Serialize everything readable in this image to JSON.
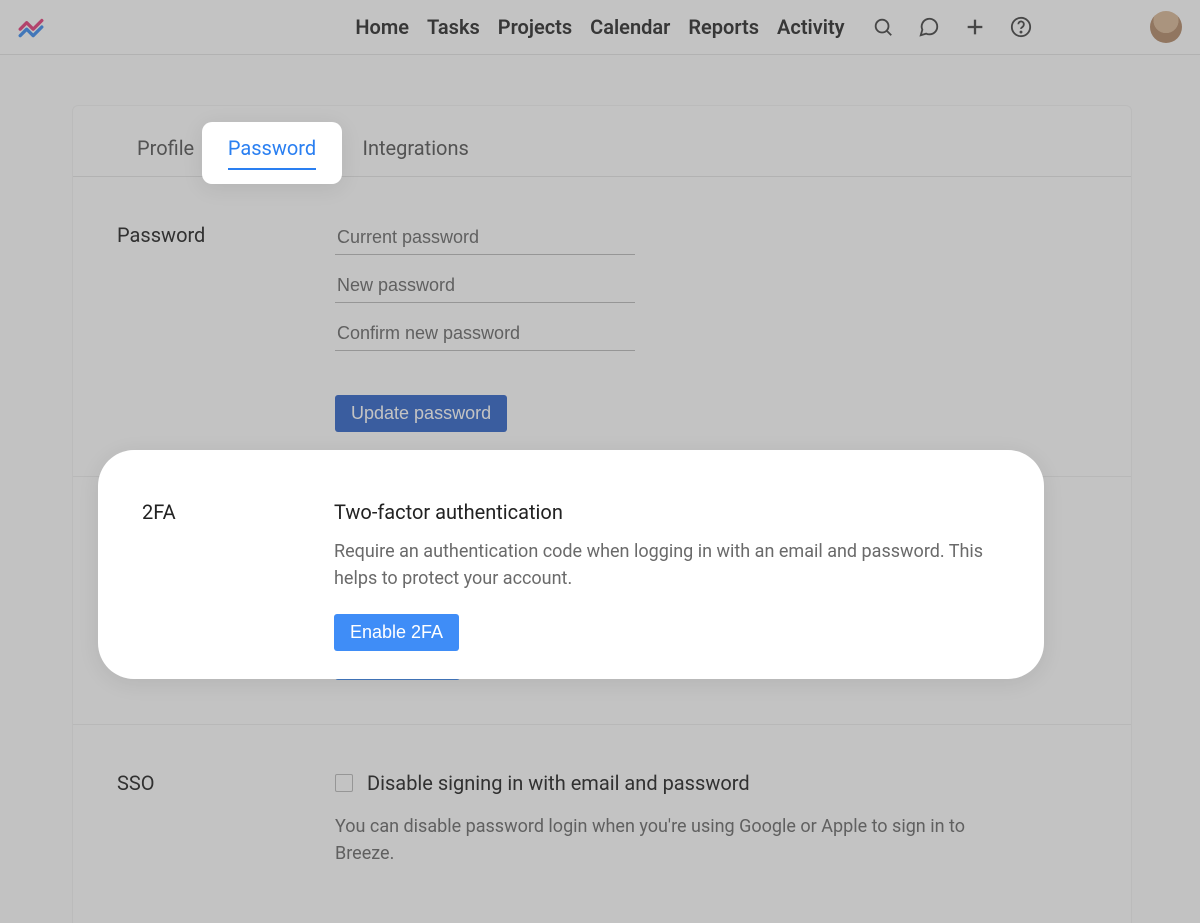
{
  "nav": {
    "items": [
      "Home",
      "Tasks",
      "Projects",
      "Calendar",
      "Reports",
      "Activity"
    ]
  },
  "tabs": {
    "profile": "Profile",
    "password": "Password",
    "integrations": "Integrations"
  },
  "password_section": {
    "label": "Password",
    "current_ph": "Current password",
    "new_ph": "New password",
    "confirm_ph": "Confirm new password",
    "update_btn": "Update password"
  },
  "tfa_section": {
    "label": "2FA",
    "heading": "Two-factor authentication",
    "desc": "Require an authentication code when logging in with an email and password. This helps to protect your account.",
    "enable_btn": "Enable 2FA"
  },
  "sso_section": {
    "label": "SSO",
    "checkbox_label": "Disable signing in with email and password",
    "desc": "You can disable password login when you're using Google or Apple to sign in to Breeze."
  }
}
